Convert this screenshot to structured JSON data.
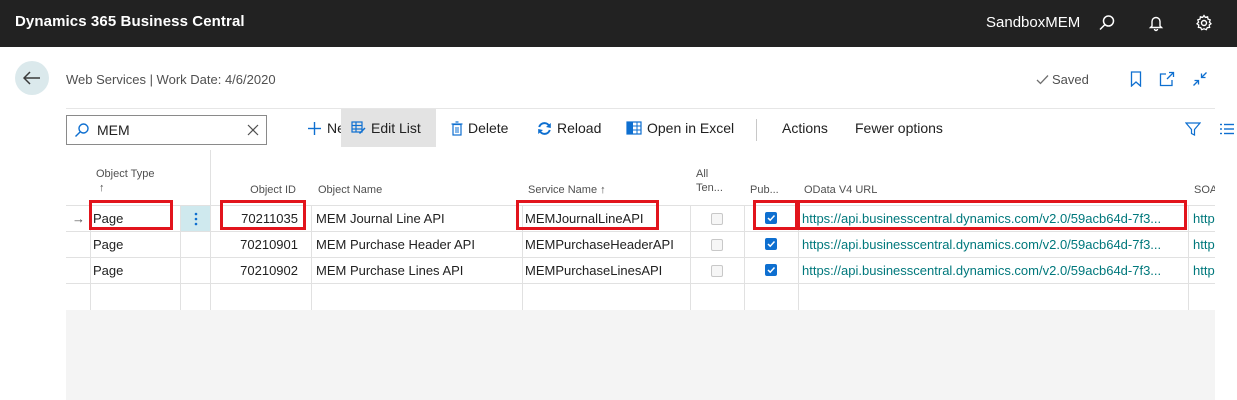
{
  "topbar": {
    "app_title": "Dynamics 365 Business Central",
    "tenant": "SandboxMEM",
    "icons": [
      "search-icon",
      "bell-icon",
      "gear-icon"
    ]
  },
  "header": {
    "breadcrumb": "Web Services | Work Date: 4/6/2020",
    "saved_label": "Saved"
  },
  "actions": {
    "search_value": "MEM",
    "new_label": "New",
    "edit_list_label": "Edit List",
    "delete_label": "Delete",
    "reload_label": "Reload",
    "open_excel_label": "Open in Excel",
    "actions_label": "Actions",
    "fewer_options_label": "Fewer options"
  },
  "table": {
    "columns": {
      "object_type": "Object Type",
      "object_type_sort": "↑",
      "object_id": "Object ID",
      "object_name": "Object Name",
      "service_name": "Service Name ↑",
      "all_tenants_1": "All",
      "all_tenants_2": "Ten...",
      "published": "Pub...",
      "odata_url": "OData V4 URL",
      "soap_url": "SOA"
    },
    "rows": [
      {
        "selected_marker": "→",
        "object_type": "Page",
        "object_id": "70211035",
        "object_name": "MEM Journal Line API",
        "service_name": "MEMJournalLineAPI",
        "all_tenants": false,
        "published": true,
        "odata_url": "https://api.businesscentral.dynamics.com/v2.0/59acb64d-7f3...",
        "soap_url": "http"
      },
      {
        "selected_marker": "",
        "object_type": "Page",
        "object_id": "70210901",
        "object_name": "MEM Purchase Header API",
        "service_name": "MEMPurchaseHeaderAPI",
        "all_tenants": false,
        "published": true,
        "odata_url": "https://api.businesscentral.dynamics.com/v2.0/59acb64d-7f3...",
        "soap_url": "http"
      },
      {
        "selected_marker": "",
        "object_type": "Page",
        "object_id": "70210902",
        "object_name": "MEM Purchase Lines API",
        "service_name": "MEMPurchaseLinesAPI",
        "all_tenants": false,
        "published": true,
        "odata_url": "https://api.businesscentral.dynamics.com/v2.0/59acb64d-7f3...",
        "soap_url": "http"
      }
    ]
  },
  "colors": {
    "topbar_bg": "#222222",
    "link": "#00787c",
    "highlight_box": "#e2141c",
    "checkbox_on": "#0e6fd0"
  }
}
